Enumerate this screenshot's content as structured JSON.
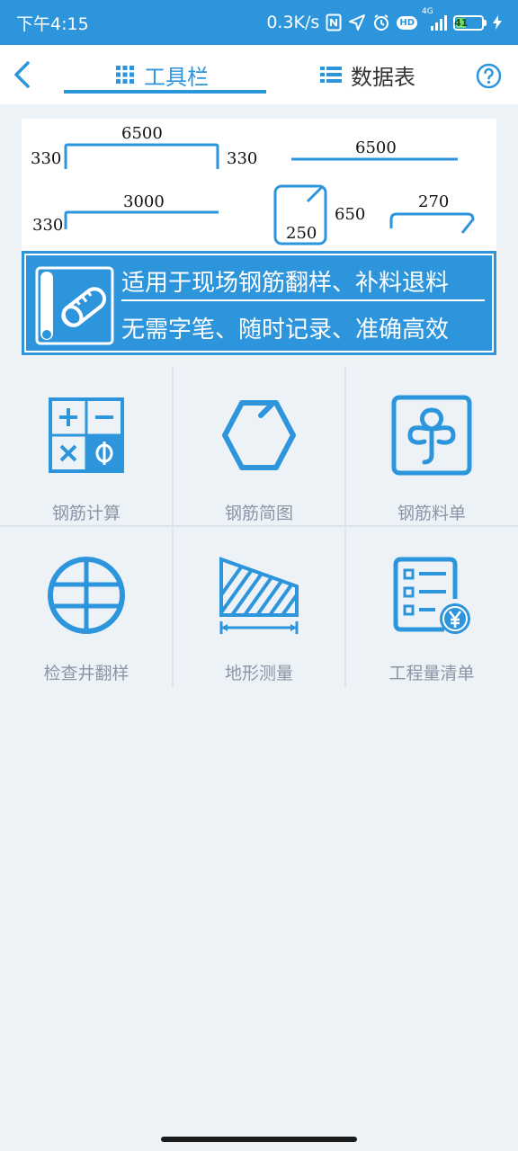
{
  "status_bar": {
    "time": "下午4:15",
    "network_speed": "0.3K/s",
    "hd_label": "HD",
    "network_type": "4G",
    "battery_level": "41"
  },
  "nav": {
    "tabs": [
      {
        "label": "工具栏",
        "icon": "grid-icon",
        "active": true
      },
      {
        "label": "数据表",
        "icon": "list-icon",
        "active": false
      }
    ]
  },
  "banner": {
    "dims": {
      "d1_length": "6500",
      "d1_left_hook": "330",
      "d1_right_hook": "330",
      "d2_length": "6500",
      "d3_length": "3000",
      "d3_hook": "330",
      "d4_height": "650",
      "d4_width": "250",
      "d5_length": "270"
    },
    "slogan_line1": "适用于现场钢筋翻样、补料退料",
    "slogan_line2": "无需字笔、随时记录、准确高效"
  },
  "tools": [
    {
      "label": "钢筋计算",
      "icon": "calculator-icon"
    },
    {
      "label": "钢筋简图",
      "icon": "hexagon-bend-icon"
    },
    {
      "label": "钢筋料单",
      "icon": "material-list-icon"
    },
    {
      "label": "检查井翻样",
      "icon": "manhole-icon"
    },
    {
      "label": "地形测量",
      "icon": "terrain-measure-icon"
    },
    {
      "label": "工程量清单",
      "icon": "bill-of-quantities-icon"
    }
  ],
  "colors": {
    "accent": "#2d95dc",
    "background": "#edf2f7",
    "label_gray": "#8a96a6"
  }
}
